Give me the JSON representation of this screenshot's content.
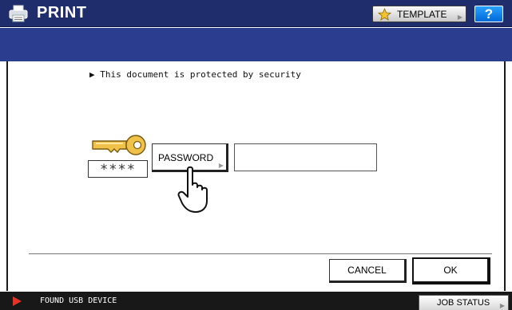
{
  "header": {
    "title": "PRINT",
    "template_label": "TEMPLATE",
    "help_label": "?",
    "bg_color": "#1f2d6c"
  },
  "icons": {
    "print": "printer-icon",
    "template": "star-icon",
    "key": "key-icon",
    "hand": "pointing-hand-icon",
    "alert": "play-arrow-icon"
  },
  "main": {
    "message": "▶ This document is protected by security",
    "password_mask": "****",
    "password_button_label": "PASSWORD",
    "password_value": ""
  },
  "footer": {
    "cancel_label": "CANCEL",
    "ok_label": "OK"
  },
  "status": {
    "text": "FOUND USB DEVICE",
    "job_status_label": "JOB STATUS"
  }
}
